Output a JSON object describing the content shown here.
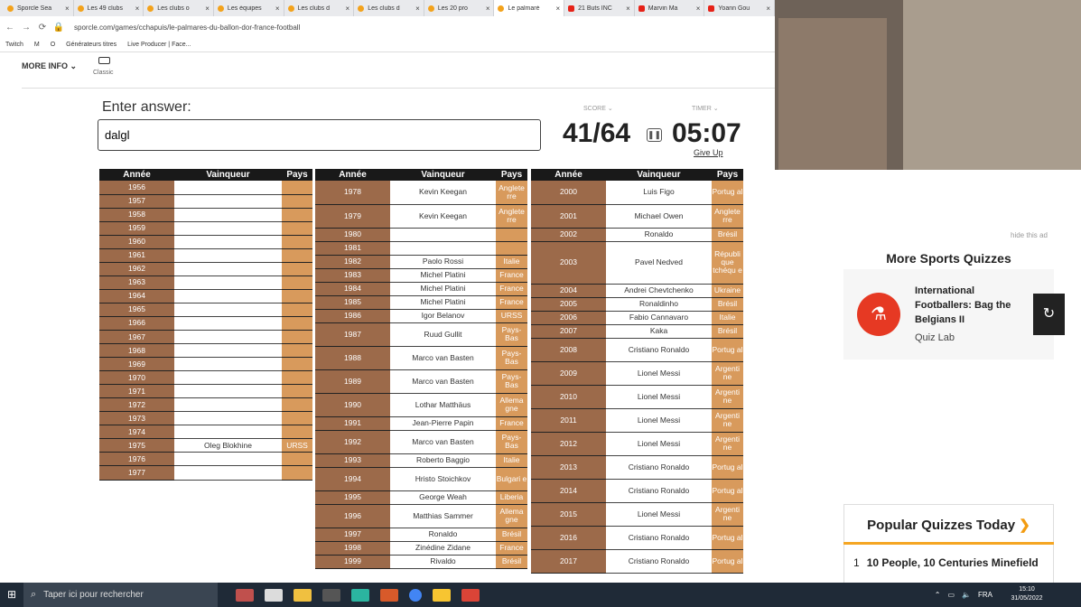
{
  "browser": {
    "tabs": [
      {
        "title": "Sporcle Sea",
        "icon": "sporcle"
      },
      {
        "title": "Les 49 clubs",
        "icon": "sporcle"
      },
      {
        "title": "Les clubs o",
        "icon": "sporcle"
      },
      {
        "title": "Les équipes",
        "icon": "sporcle"
      },
      {
        "title": "Les clubs d",
        "icon": "sporcle"
      },
      {
        "title": "Les clubs d",
        "icon": "sporcle"
      },
      {
        "title": "Les 20 pro",
        "icon": "sporcle"
      },
      {
        "title": "Le palmarè",
        "icon": "sporcle",
        "active": true
      },
      {
        "title": "21 Buts INC",
        "icon": "youtube"
      },
      {
        "title": "Marvin Ma",
        "icon": "youtube"
      },
      {
        "title": "Yoann Gou",
        "icon": "youtube"
      }
    ],
    "url": "sporcle.com/games/cchapuis/le-palmares-du-ballon-dor-france-football",
    "bookmarks": [
      "Twitch",
      "M",
      "O",
      "Générateurs titres",
      "Live Producer | Face..."
    ]
  },
  "header": {
    "more_info": "MORE INFO",
    "classic": "Classic"
  },
  "quiz": {
    "enter_label": "Enter answer:",
    "answer_value": "dalgl",
    "score_label": "SCORE",
    "timer_label": "TIMER",
    "score": "41/64",
    "timer": "05:07",
    "give_up": "Give Up"
  },
  "table_headers": {
    "year": "Année",
    "winner": "Vainqueur",
    "country": "Pays"
  },
  "table1": [
    [
      "1956",
      "",
      ""
    ],
    [
      "1957",
      "",
      ""
    ],
    [
      "1958",
      "",
      ""
    ],
    [
      "1959",
      "",
      ""
    ],
    [
      "1960",
      "",
      ""
    ],
    [
      "1961",
      "",
      ""
    ],
    [
      "1962",
      "",
      ""
    ],
    [
      "1963",
      "",
      ""
    ],
    [
      "1964",
      "",
      ""
    ],
    [
      "1965",
      "",
      ""
    ],
    [
      "1966",
      "",
      ""
    ],
    [
      "1967",
      "",
      ""
    ],
    [
      "1968",
      "",
      ""
    ],
    [
      "1969",
      "",
      ""
    ],
    [
      "1970",
      "",
      ""
    ],
    [
      "1971",
      "",
      ""
    ],
    [
      "1972",
      "",
      ""
    ],
    [
      "1973",
      "",
      ""
    ],
    [
      "1974",
      "",
      ""
    ],
    [
      "1975",
      "Oleg Blokhine",
      "URSS"
    ],
    [
      "1976",
      "",
      ""
    ],
    [
      "1977",
      "",
      ""
    ]
  ],
  "table2": [
    [
      "1978",
      "Kevin Keegan",
      "Anglete rre"
    ],
    [
      "1979",
      "Kevin Keegan",
      "Anglete rre"
    ],
    [
      "1980",
      "",
      ""
    ],
    [
      "1981",
      "",
      ""
    ],
    [
      "1982",
      "Paolo Rossi",
      "Italie"
    ],
    [
      "1983",
      "Michel Platini",
      "France"
    ],
    [
      "1984",
      "Michel Platini",
      "France"
    ],
    [
      "1985",
      "Michel Platini",
      "France"
    ],
    [
      "1986",
      "Igor Belanov",
      "URSS"
    ],
    [
      "1987",
      "Ruud Gullit",
      "Pays-Bas"
    ],
    [
      "1988",
      "Marco van Basten",
      "Pays-Bas"
    ],
    [
      "1989",
      "Marco van Basten",
      "Pays-Bas"
    ],
    [
      "1990",
      "Lothar Matthäus",
      "Allema gne"
    ],
    [
      "1991",
      "Jean-Pierre Papin",
      "France"
    ],
    [
      "1992",
      "Marco van Basten",
      "Pays-Bas"
    ],
    [
      "1993",
      "Roberto Baggio",
      "Italie"
    ],
    [
      "1994",
      "Hristo Stoichkov",
      "Bulgari e"
    ],
    [
      "1995",
      "George Weah",
      "Liberia"
    ],
    [
      "1996",
      "Matthias Sammer",
      "Allema gne"
    ],
    [
      "1997",
      "Ronaldo",
      "Brésil"
    ],
    [
      "1998",
      "Zinédine Zidane",
      "France"
    ],
    [
      "1999",
      "Rivaldo",
      "Brésil"
    ]
  ],
  "table3": [
    [
      "2000",
      "Luis Figo",
      "Portug al"
    ],
    [
      "2001",
      "Michael Owen",
      "Anglete rre"
    ],
    [
      "2002",
      "Ronaldo",
      "Brésil"
    ],
    [
      "2003",
      "Pavel Nedved",
      "Républi que tchéqu e"
    ],
    [
      "2004",
      "Andrei Chevtchenko",
      "Ukraine"
    ],
    [
      "2005",
      "Ronaldinho",
      "Brésil"
    ],
    [
      "2006",
      "Fabio Cannavaro",
      "Italie"
    ],
    [
      "2007",
      "Kaka",
      "Brésil"
    ],
    [
      "2008",
      "Cristiano Ronaldo",
      "Portug al"
    ],
    [
      "2009",
      "Lionel Messi",
      "Argenti ne"
    ],
    [
      "2010",
      "Lionel Messi",
      "Argenti ne"
    ],
    [
      "2011",
      "Lionel Messi",
      "Argenti ne"
    ],
    [
      "2012",
      "Lionel Messi",
      "Argenti ne"
    ],
    [
      "2013",
      "Cristiano Ronaldo",
      "Portug al"
    ],
    [
      "2014",
      "Cristiano Ronaldo",
      "Portug al"
    ],
    [
      "2015",
      "Lionel Messi",
      "Argenti ne"
    ],
    [
      "2016",
      "Cristiano Ronaldo",
      "Portug al"
    ],
    [
      "2017",
      "Cristiano Ronaldo",
      "Portug al"
    ]
  ],
  "sidebar": {
    "hide_ad": "hide this ad",
    "more_sports": "More Sports Quizzes",
    "quiz_title": "International Footballers: Bag the Belgians II",
    "quiz_author": "Quiz Lab",
    "popular_title": "Popular Quizzes Today",
    "popular_arrow": "❯",
    "popular_num": "1",
    "popular_item": "10 People, 10 Centuries Minefield"
  },
  "taskbar": {
    "search_placeholder": "Taper ici pour rechercher",
    "lang": "FRA",
    "time": "15:10",
    "date": "31/05/2022"
  },
  "colors": {
    "year_cell": "#9c6a4a",
    "country_cell": "#d89a5c",
    "header": "#191919",
    "accent": "#f39c12"
  }
}
